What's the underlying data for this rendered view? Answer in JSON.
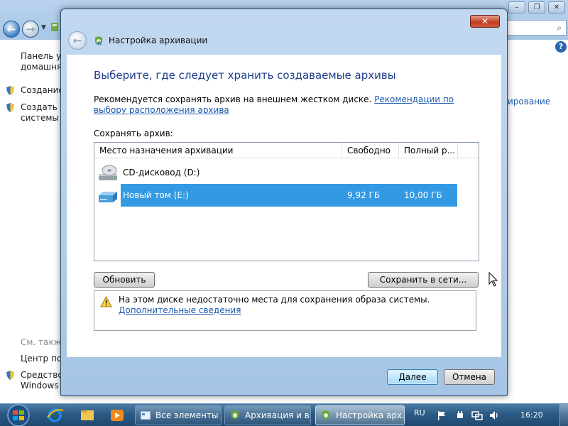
{
  "background_window": {
    "search_glyph": "⌕",
    "help_glyph": "?",
    "controls": [
      "–",
      "❐",
      "✕"
    ],
    "sidebar": {
      "items": [
        {
          "label": "Панель уп\nдомашняя",
          "shield": false
        },
        {
          "label": "Создание",
          "shield": true
        },
        {
          "label": "Создать ди\nсистемы",
          "shield": true
        }
      ],
      "see_also": "См. также",
      "bottom_items": [
        {
          "label": "Центр под",
          "shield": false
        },
        {
          "label": "Средство\nWindows",
          "shield": true
        }
      ]
    },
    "right_link": "ирование"
  },
  "dialog": {
    "title": "Настройка архивации",
    "close_glyph": "✕",
    "back_glyph": "←",
    "heading": "Выберите, где следует хранить создаваемые архивы",
    "intro_text": "Рекомендуется сохранять архив на внешнем жестком диске. ",
    "intro_link": "Рекомендации по выбору расположения архива",
    "save_label": "Сохранять архив:",
    "columns": [
      "Место назначения архивации",
      "Свободно",
      "Полный р..."
    ],
    "drives": [
      {
        "name": "CD-дисковод (D:)",
        "free": "",
        "total": "",
        "selected": false,
        "type": "cd"
      },
      {
        "name": "Новый том (E:)",
        "free": "9,92 ГБ",
        "total": "10,00 ГБ",
        "selected": true,
        "type": "hdd"
      }
    ],
    "refresh_button": "Обновить",
    "network_button": "Сохранить в сети...",
    "warning_text": "На этом диске недостаточно места для сохранения образа системы. ",
    "warning_link": "Дополнительные сведения",
    "next_button": "Далее",
    "cancel_button": "Отмена"
  },
  "taskbar": {
    "tasks": [
      {
        "label": "Все элементы ...",
        "active": false
      },
      {
        "label": "Архивация и в...",
        "active": false
      },
      {
        "label": "Настройка арх...",
        "active": true
      }
    ],
    "language": "RU",
    "clock": "16:20"
  }
}
